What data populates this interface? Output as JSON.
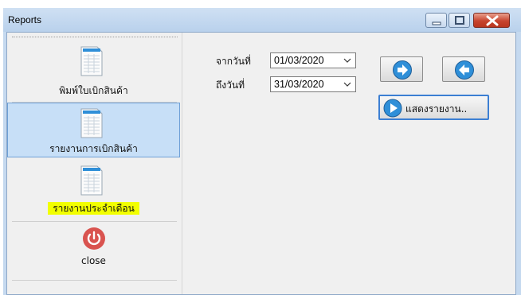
{
  "window": {
    "title": "Reports"
  },
  "sidebar": {
    "items": [
      {
        "label": "พิมพ์ใบเบิกสินค้า",
        "icon": "report-document-icon",
        "selected": false
      },
      {
        "label": "รายงานการเบิกสินค้า",
        "icon": "report-document-icon",
        "selected": true
      },
      {
        "label": "รายงานประจำเดือน",
        "icon": "report-document-icon",
        "selected": false,
        "highlighted": true
      },
      {
        "label": "close",
        "icon": "power-icon",
        "selected": false
      }
    ]
  },
  "filters": {
    "from_label": "จากวันที่",
    "from_value": "01/03/2020",
    "to_label": "ถึงวันที่",
    "to_value": "31/03/2020"
  },
  "buttons": {
    "next_icon": "arrow-right-icon",
    "prev_icon": "arrow-left-icon",
    "show_report_label": "แสดงรายงาน.."
  },
  "colors": {
    "title_bar": "#b9d1ec",
    "selected_item": "#c7dff7",
    "highlight": "#f2ff00",
    "close_button": "#c7442e",
    "power_icon": "#d9534f",
    "nav_icon": "#2f8fd8"
  }
}
